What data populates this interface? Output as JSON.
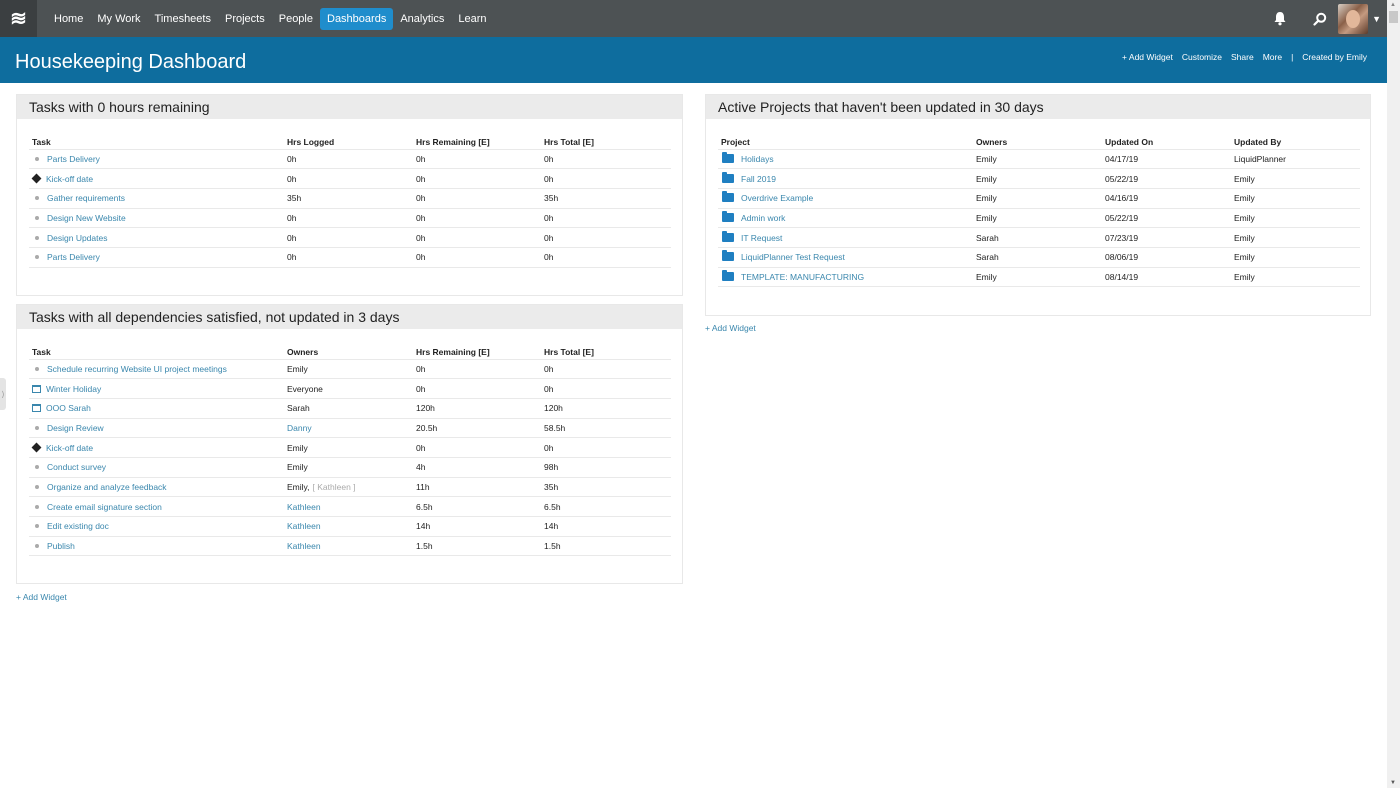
{
  "nav": {
    "logo_icon": "waves-logo-icon",
    "items": [
      {
        "label": "Home",
        "active": false
      },
      {
        "label": "My Work",
        "active": false
      },
      {
        "label": "Timesheets",
        "active": false
      },
      {
        "label": "Projects",
        "active": false
      },
      {
        "label": "People",
        "active": false
      },
      {
        "label": "Dashboards",
        "active": true
      },
      {
        "label": "Analytics",
        "active": false
      },
      {
        "label": "Learn",
        "active": false
      }
    ],
    "right_icons": [
      "bell-icon",
      "search-icon",
      "avatar",
      "caret-down-icon"
    ]
  },
  "header": {
    "title": "Housekeeping Dashboard",
    "actions": {
      "add_widget": "+ Add Widget",
      "customize": "Customize",
      "share": "Share",
      "more": "More",
      "separator": "|",
      "created_by": "Created by Emily"
    }
  },
  "widget1": {
    "title": "Tasks with 0 hours remaining",
    "columns": [
      "Task",
      "Hrs Logged",
      "Hrs Remaining [E]",
      "Hrs Total [E]"
    ],
    "rows": [
      {
        "icon": "bullet",
        "task": "Parts Delivery",
        "logged": "0h",
        "remaining": "0h",
        "total": "0h"
      },
      {
        "icon": "diamond",
        "task": "Kick-off date",
        "logged": "0h",
        "remaining": "0h",
        "total": "0h"
      },
      {
        "icon": "bullet",
        "task": "Gather requirements",
        "logged": "35h",
        "remaining": "0h",
        "total": "35h"
      },
      {
        "icon": "bullet",
        "task": "Design New Website",
        "logged": "0h",
        "remaining": "0h",
        "total": "0h"
      },
      {
        "icon": "bullet",
        "task": "Design Updates",
        "logged": "0h",
        "remaining": "0h",
        "total": "0h"
      },
      {
        "icon": "bullet",
        "task": "Parts Delivery",
        "logged": "0h",
        "remaining": "0h",
        "total": "0h"
      }
    ]
  },
  "widget2": {
    "title": "Tasks with all dependencies satisfied, not updated in 3 days",
    "columns": [
      "Task",
      "Owners",
      "Hrs Remaining [E]",
      "Hrs Total [E]"
    ],
    "rows": [
      {
        "icon": "bullet",
        "task": "Schedule recurring Website UI project meetings",
        "owner": "Emily",
        "owner_extra": "",
        "owner_link": false,
        "remaining": "0h",
        "total": "0h"
      },
      {
        "icon": "calendar",
        "task": "Winter Holiday",
        "owner": "Everyone",
        "owner_extra": "",
        "owner_link": false,
        "remaining": "0h",
        "total": "0h"
      },
      {
        "icon": "calendar",
        "task": "OOO Sarah",
        "owner": "Sarah",
        "owner_extra": "",
        "owner_link": false,
        "remaining": "120h",
        "total": "120h"
      },
      {
        "icon": "bullet",
        "task": "Design Review",
        "owner": "Danny",
        "owner_extra": "",
        "owner_link": true,
        "remaining": "20.5h",
        "total": "58.5h"
      },
      {
        "icon": "diamond",
        "task": "Kick-off date",
        "owner": "Emily",
        "owner_extra": "",
        "owner_link": false,
        "remaining": "0h",
        "total": "0h"
      },
      {
        "icon": "bullet",
        "task": "Conduct survey",
        "owner": "Emily",
        "owner_extra": "",
        "owner_link": false,
        "remaining": "4h",
        "total": "98h"
      },
      {
        "icon": "bullet",
        "task": "Organize and analyze feedback",
        "owner": "Emily,",
        "owner_extra": "[ Kathleen ]",
        "owner_link": false,
        "remaining": "11h",
        "total": "35h"
      },
      {
        "icon": "bullet",
        "task": "Create email signature section",
        "owner": "Kathleen",
        "owner_extra": "",
        "owner_link": true,
        "remaining": "6.5h",
        "total": "6.5h"
      },
      {
        "icon": "bullet",
        "task": "Edit existing doc",
        "owner": "Kathleen",
        "owner_extra": "",
        "owner_link": true,
        "remaining": "14h",
        "total": "14h"
      },
      {
        "icon": "bullet",
        "task": "Publish",
        "owner": "Kathleen",
        "owner_extra": "",
        "owner_link": true,
        "remaining": "1.5h",
        "total": "1.5h"
      }
    ]
  },
  "widget3": {
    "title": "Active Projects that haven't been updated in 30 days",
    "columns": [
      "Project",
      "Owners",
      "Updated On",
      "Updated By"
    ],
    "rows": [
      {
        "project": "Holidays",
        "owner": "Emily",
        "updated_on": "04/17/19",
        "updated_by": "LiquidPlanner"
      },
      {
        "project": "Fall 2019",
        "owner": "Emily",
        "updated_on": "05/22/19",
        "updated_by": "Emily"
      },
      {
        "project": "Overdrive Example",
        "owner": "Emily",
        "updated_on": "04/16/19",
        "updated_by": "Emily"
      },
      {
        "project": "Admin work",
        "owner": "Emily",
        "updated_on": "05/22/19",
        "updated_by": "Emily"
      },
      {
        "project": "IT Request",
        "owner": "Sarah",
        "updated_on": "07/23/19",
        "updated_by": "Emily"
      },
      {
        "project": "LiquidPlanner Test Request",
        "owner": "Sarah",
        "updated_on": "08/06/19",
        "updated_by": "Emily"
      },
      {
        "project": "TEMPLATE: MANUFACTURING",
        "owner": "Emily",
        "updated_on": "08/14/19",
        "updated_by": "Emily"
      }
    ]
  },
  "add_widget_left": "+ Add Widget",
  "add_widget_right": "+ Add Widget",
  "colors": {
    "nav_bg": "#4d5254",
    "nav_active": "#1f8dcc",
    "header_bg": "#0e6d9e",
    "link": "#3a87ad",
    "folder": "#1f7fc1"
  }
}
